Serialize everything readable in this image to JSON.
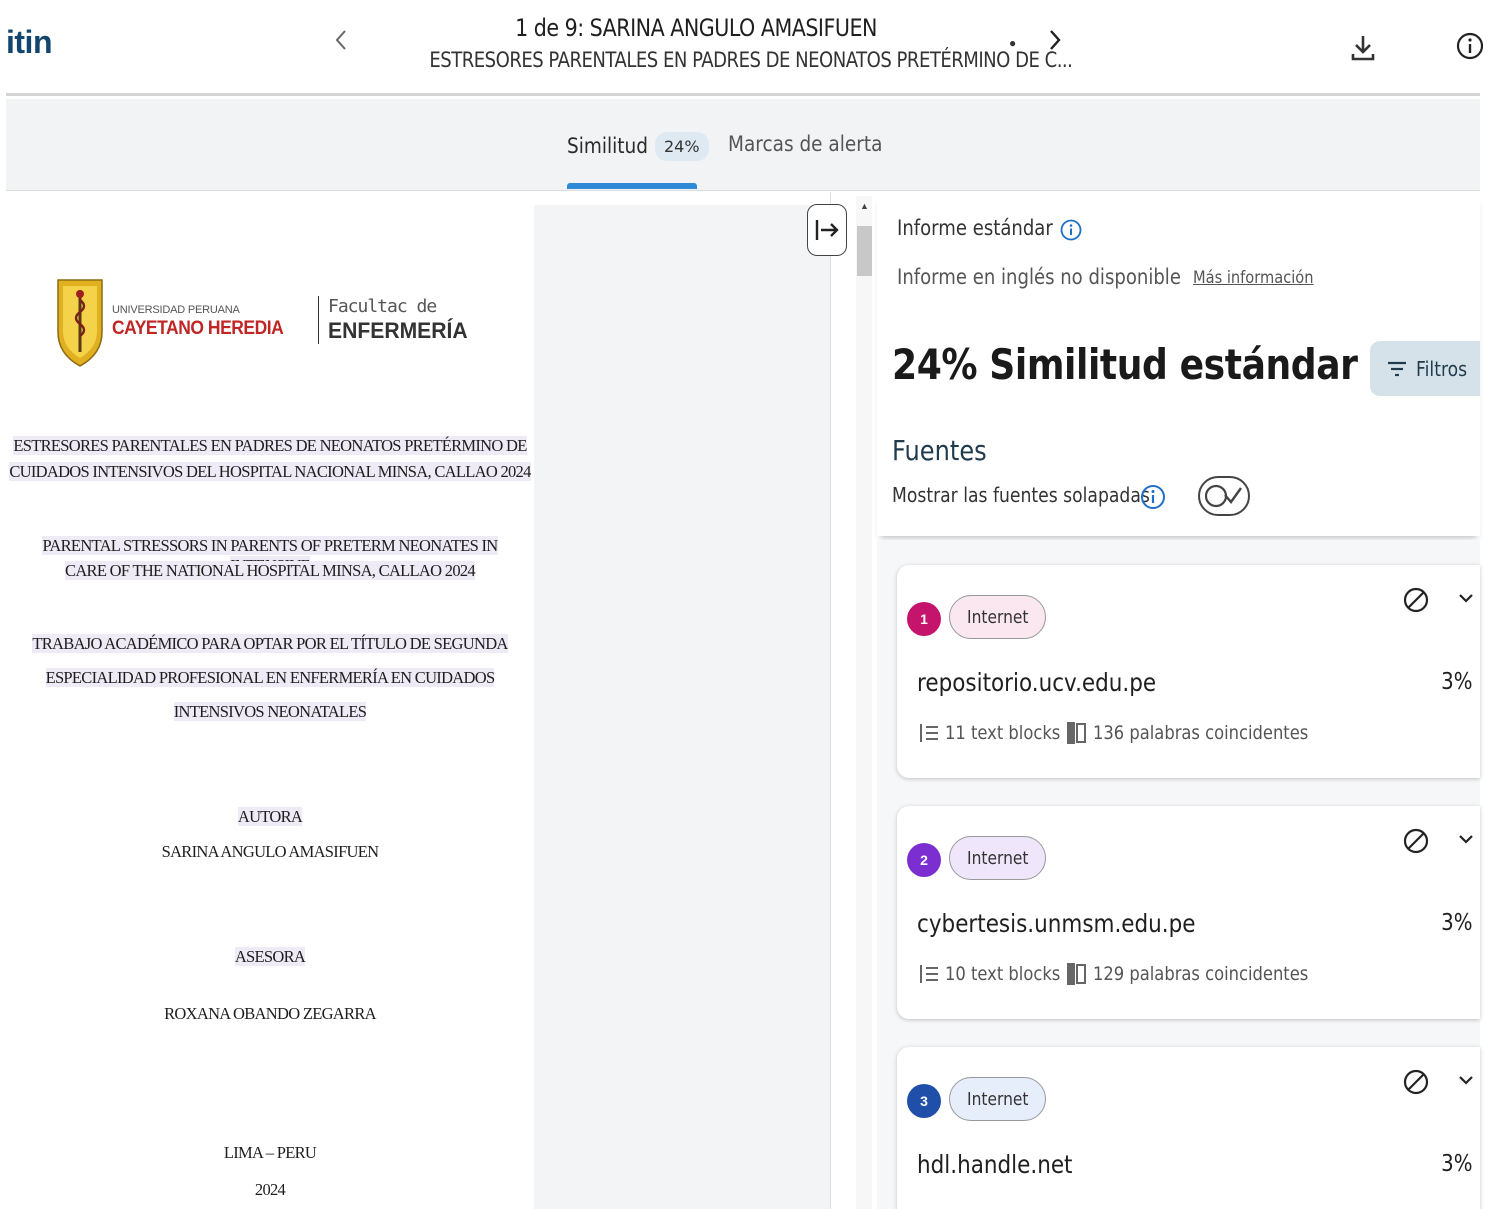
{
  "header": {
    "logo_text": "itin",
    "title": "1 de 9: SARINA ANGULO AMASIFUEN",
    "subtitle": "ESTRESORES PARENTALES EN PADRES DE NEONATOS PRETÉRMINO DE C...",
    "prev_icon": "chevron-left-icon",
    "next_icon": "chevron-right-icon",
    "download_icon": "download-icon",
    "info_icon": "info-icon"
  },
  "tabs": {
    "similitud_label": "Similitud",
    "similitud_badge": "24%",
    "alertas_label": "Marcas de alerta",
    "active_color": "#2f8ad6"
  },
  "document": {
    "university_line1": "UNIVERSIDAD PERUANA",
    "university_line2": "CAYETANO HEREDIA",
    "faculty_line1": "Facultac de",
    "faculty_line2": "ENFERMERÍA",
    "title_es_1": "ESTRESORES PARENTALES EN PADRES DE NEONATOS PRETÉRMINO DE",
    "title_es_2": "CUIDADOS INTENSIVOS DEL HOSPITAL NACIONAL MINSA, CALLAO 2024",
    "title_en_1": "PARENTAL STRESSORS IN PARENTS OF PRETERM NEONATES IN INTENSIVE",
    "title_en_2": "CARE OF THE NATIONAL HOSPITAL MINSA, CALLAO  2024",
    "trabajo_1": "TRABAJO ACADÉMICO PARA OPTAR POR EL TÍTULO DE SEGUNDA",
    "trabajo_2": "ESPECIALIDAD PROFESIONAL EN ENFERMERÍA EN CUIDADOS",
    "trabajo_3": "INTENSIVOS NEONATALES",
    "autora_label": "AUTORA",
    "autora_name": "SARINA ANGULO AMASIFUEN",
    "asesora_label": "ASESORA",
    "asesora_name": "ROXANA OBANDO ZEGARRA",
    "city": "LIMA – PERU",
    "year": "2024"
  },
  "panel": {
    "informe_label": "Informe estándar",
    "informe_en_label": "Informe en inglés no disponible",
    "mas_info_label": "Más información",
    "similarity_heading": "24% Similitud estándar",
    "filtros_label": "Filtros",
    "fuentes_label": "Fuentes",
    "solapadas_label": "Mostrar las fuentes solapadas"
  },
  "sources": [
    {
      "number": "1",
      "type": "Internet",
      "name": "repositorio.ucv.edu.pe",
      "percent": "3%",
      "blocks": "11 text blocks",
      "words": "136 palabras coincidentes",
      "color": "#c4146c",
      "chip_bg": "#fbe7f0"
    },
    {
      "number": "2",
      "type": "Internet",
      "name": "cybertesis.unmsm.edu.pe",
      "percent": "3%",
      "blocks": "10 text blocks",
      "words": "129 palabras coincidentes",
      "color": "#7b2fd0",
      "chip_bg": "#efe6fb"
    },
    {
      "number": "3",
      "type": "Internet",
      "name": "hdl.handle.net",
      "percent": "3%",
      "blocks": "",
      "words": "",
      "color": "#1f4fa8",
      "chip_bg": "#e6eefb"
    }
  ]
}
